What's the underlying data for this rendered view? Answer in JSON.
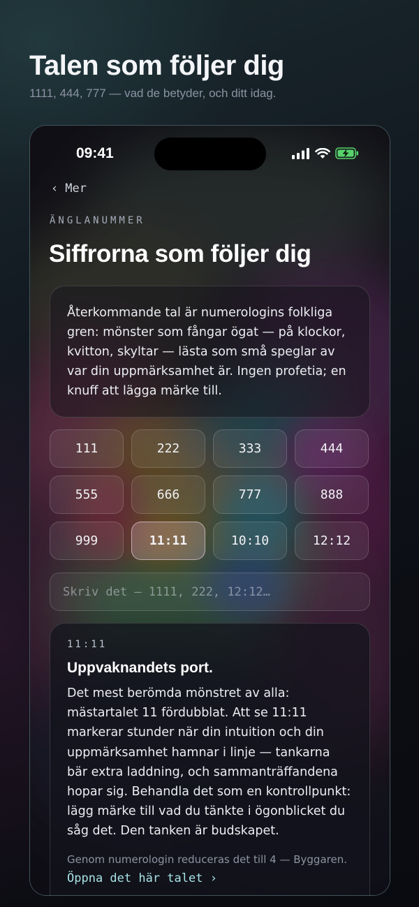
{
  "header": {
    "title": "Talen som följer dig",
    "subtitle": "1111, 444, 777 — vad de betyder, och ditt idag."
  },
  "status_bar": {
    "time": "09:41",
    "icons": [
      "cellular-signal-icon",
      "wifi-icon",
      "battery-charging-icon"
    ]
  },
  "nav": {
    "back_label": "Mer",
    "back_icon": "chevron-left-icon"
  },
  "screen": {
    "eyebrow": "ÄNGLANUMMER",
    "title": "Siffrorna som följer dig",
    "intro": "Återkommande tal är numerologins folkliga gren: mönster som fångar ögat — på klockor, kvitton, skyltar — lästa som små speglar av var din uppmärksamhet är. Ingen profetia; en knuff att lägga märke till."
  },
  "numbers": [
    "111",
    "222",
    "333",
    "444",
    "555",
    "666",
    "777",
    "888",
    "999",
    "11:11",
    "10:10",
    "12:12"
  ],
  "selected_number": "11:11",
  "search": {
    "placeholder": "Skriv det — 1111, 222, 12:12…",
    "value": ""
  },
  "result": {
    "code": "11:11",
    "title": "Uppvaknandets port.",
    "body": "Det mest berömda mönstret av alla: mästartalet 11 fördubblat. Att se 11:11 markerar stunder när din intuition och din uppmärksamhet hamnar i linje — tankarna bär extra laddning, och sammanträffandena hopar sig. Behandla det som en kontrollpunkt: lägg märke till vad du tänkte i ögonblicket du såg det. Den tanken är budskapet.",
    "footnote": "Genom numerologin reduceras det till 4 — Byggaren.",
    "link_label": "Öppna det här talet",
    "link_icon": "chevron-right-icon"
  }
}
